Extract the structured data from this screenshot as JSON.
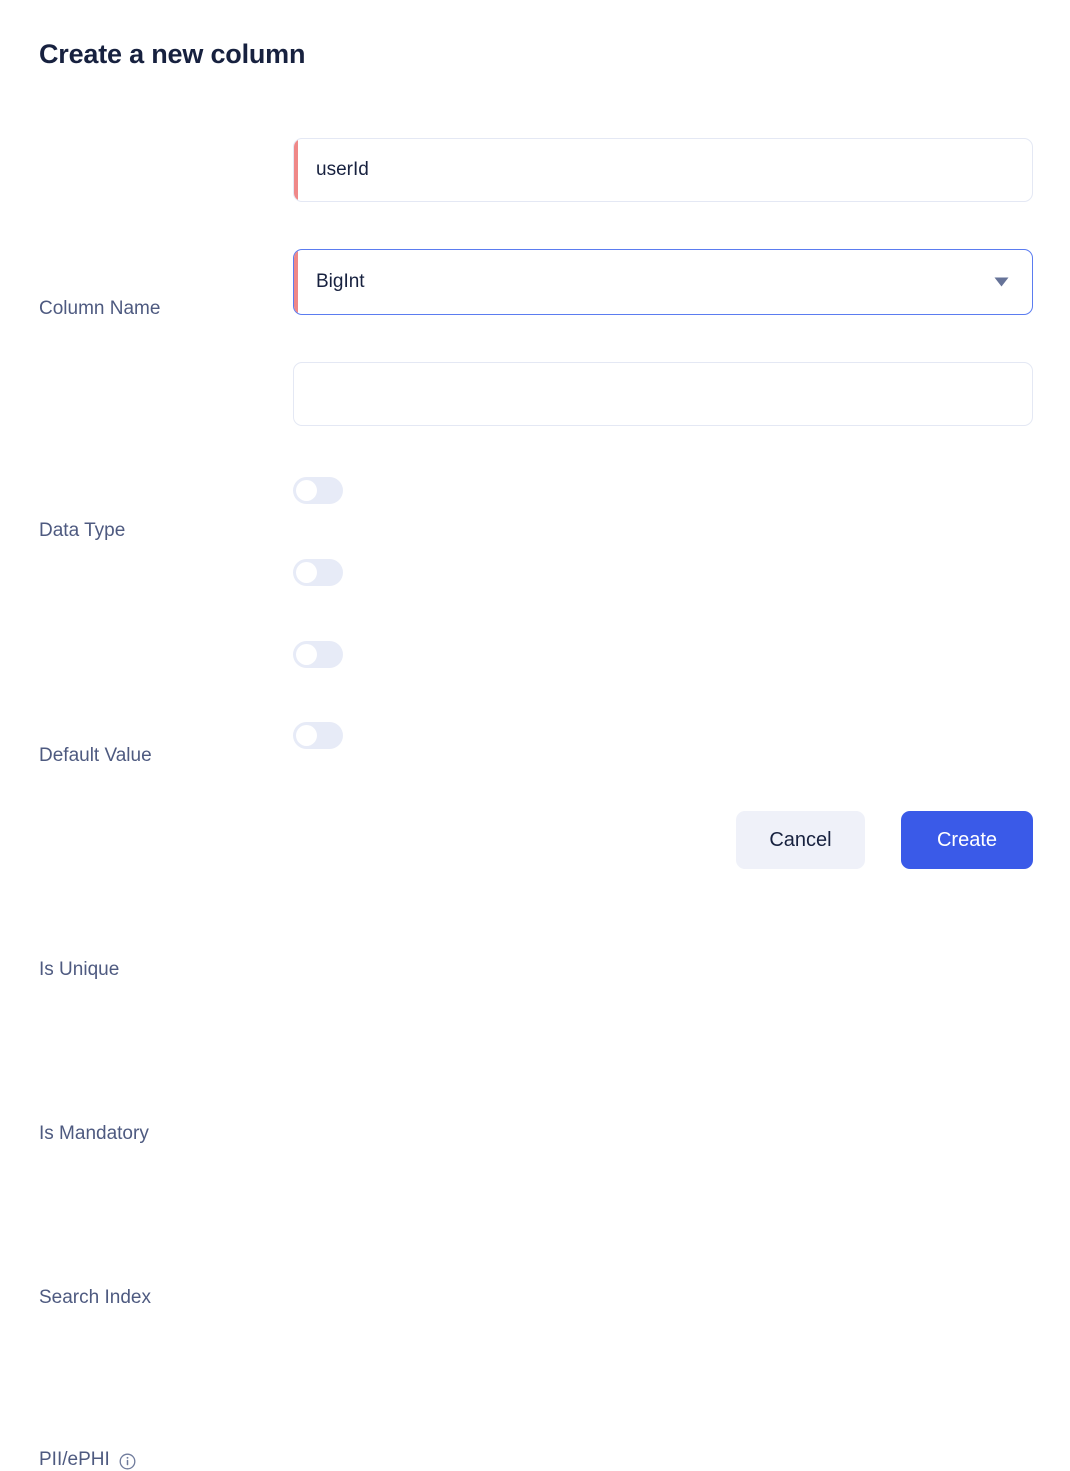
{
  "dialog": {
    "title": "Create a new column"
  },
  "fields": {
    "column_name": {
      "label": "Column Name",
      "value": "userId",
      "placeholder": "",
      "required": true
    },
    "data_type": {
      "label": "Data Type",
      "value": "BigInt",
      "required": true,
      "focused": true,
      "caret_icon": "chevron-down-icon",
      "options": [
        "BigInt"
      ]
    },
    "default_value": {
      "label": "Default Value",
      "value": "",
      "placeholder": "",
      "required": false
    }
  },
  "toggles": [
    {
      "label": "Is Unique",
      "state": "off"
    },
    {
      "label": "Is Mandatory",
      "state": "off"
    },
    {
      "label": "Search Index",
      "state": "off"
    },
    {
      "label": "PII/ePHI",
      "state": "off",
      "info_icon": "info-icon"
    }
  ],
  "footer": {
    "cancel_label": "Cancel",
    "create_label": "Create"
  },
  "colors": {
    "accent_blue": "#3a5ae8",
    "focus_border": "#5b7cf0",
    "required_bar": "#ef8888",
    "label_text": "#4e5a80",
    "title_text": "#17213f",
    "toggle_track_off": "#e7ebf7",
    "input_border": "#e4e8f4",
    "cancel_bg": "#eff1f9"
  }
}
